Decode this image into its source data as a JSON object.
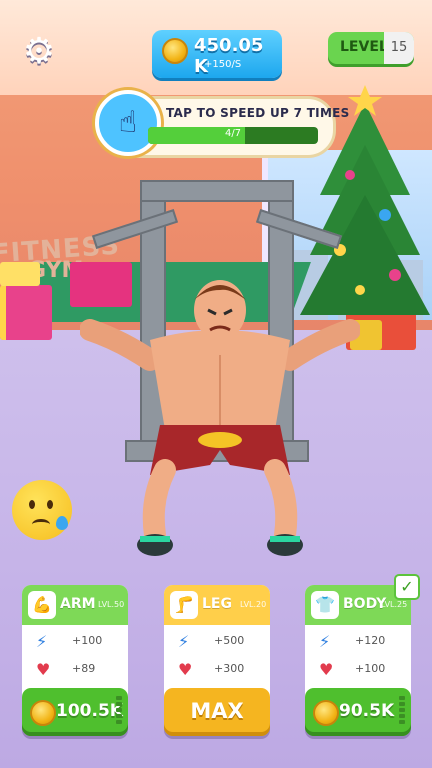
{
  "hud": {
    "settings_icon": "gear-icon",
    "coins": "450.05 K",
    "coin_rate": "+150/S",
    "level_label": "LEVEL",
    "level_value": "15"
  },
  "banner": {
    "text": "TAP TO SPEED UP 7 TIMES",
    "progress_text": "4/7",
    "progress_fraction": 0.5714,
    "icon": "tap-hand-icon"
  },
  "scene": {
    "wall_sign_line1": "FITNESS",
    "wall_sign_line2": "GYM",
    "mood": "sad-sweat-emoji"
  },
  "cards": [
    {
      "name": "ARM",
      "level": "LVL.50",
      "speed": "+100",
      "health": "+89",
      "price": "100.5K",
      "color": "#7ed957",
      "button_color": "#4fbf2e"
    },
    {
      "name": "LEG",
      "level": "LVL.20",
      "speed": "+500",
      "health": "+300",
      "price": "MAX",
      "color": "#ffcf4a",
      "button_color": "#f5b520"
    },
    {
      "name": "BODY",
      "level": "LVL.25",
      "speed": "+120",
      "health": "+100",
      "price": "90.5K",
      "color": "#7ed957",
      "button_color": "#4fbf2e"
    }
  ]
}
